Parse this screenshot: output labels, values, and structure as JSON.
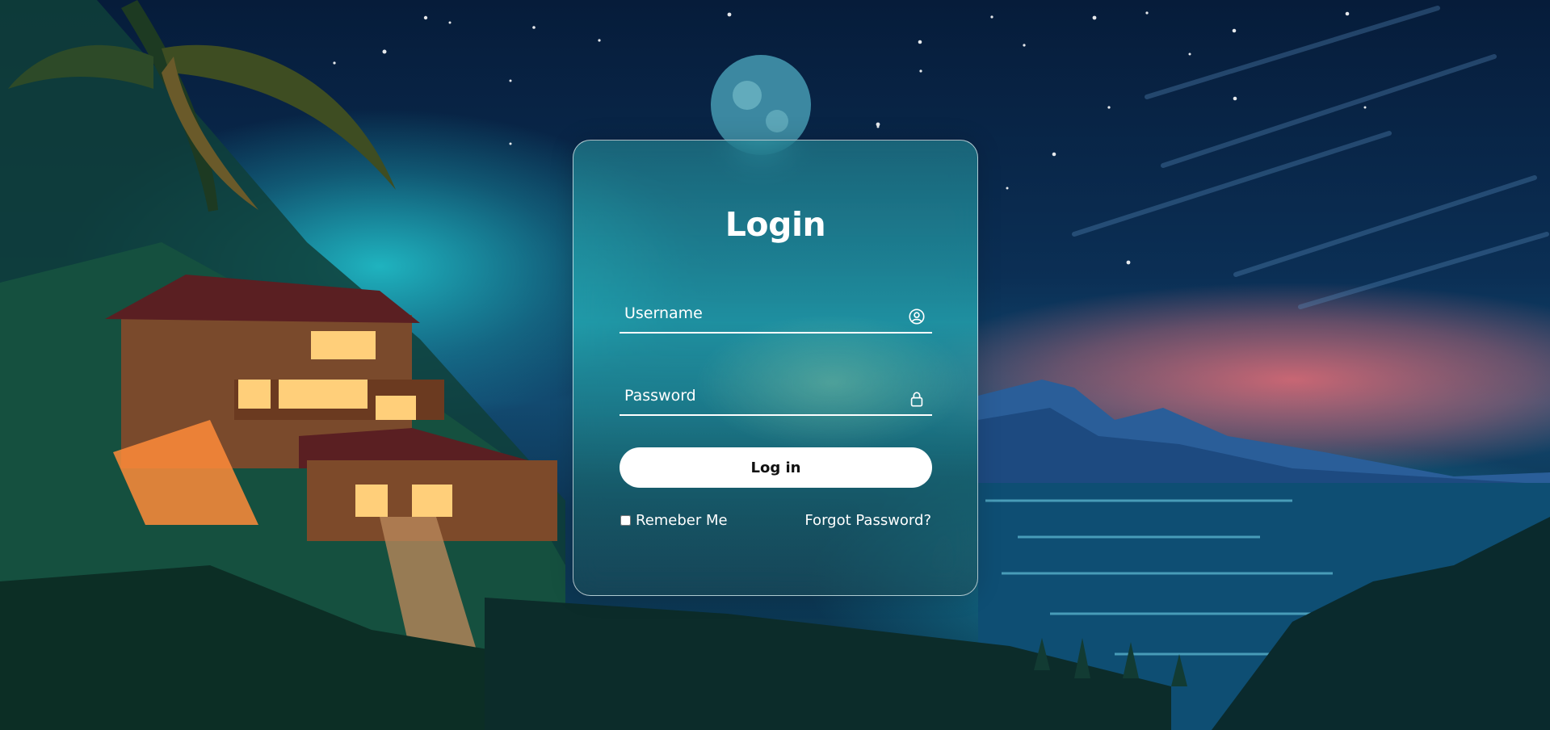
{
  "login": {
    "title": "Login",
    "username_placeholder": "Username",
    "password_placeholder": "Password",
    "submit_label": "Log in",
    "remember_label": "Remeber Me",
    "forgot_label": "Forgot Password?"
  },
  "icons": {
    "username": "user-circle-icon",
    "password": "lock-icon"
  },
  "colors": {
    "button_bg": "#ffffff",
    "text": "#ffffff"
  }
}
